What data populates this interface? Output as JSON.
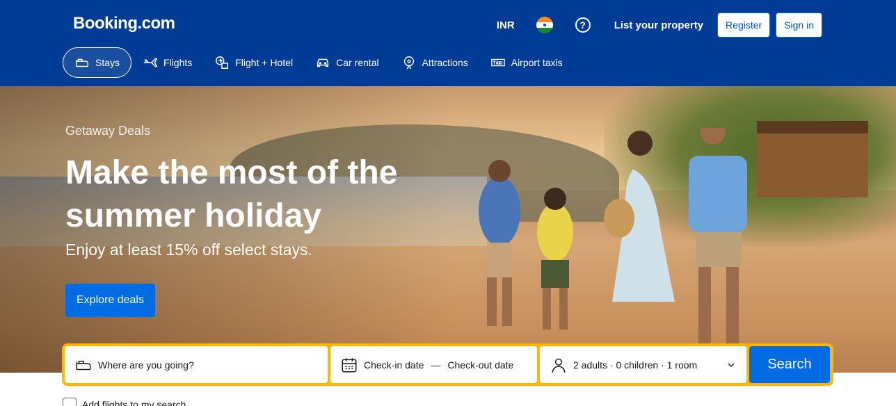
{
  "header": {
    "logo": "Booking.com",
    "currency": "INR",
    "help_icon_text": "?",
    "list_property": "List your property",
    "register": "Register",
    "sign_in": "Sign in",
    "icons": {
      "flag": "india-flag-icon",
      "help": "help-icon"
    }
  },
  "nav": {
    "items": [
      {
        "label": "Stays",
        "icon": "bed-icon",
        "active": true
      },
      {
        "label": "Flights",
        "icon": "plane-icon",
        "active": false
      },
      {
        "label": "Flight + Hotel",
        "icon": "flight-hotel-icon",
        "active": false
      },
      {
        "label": "Car rental",
        "icon": "car-icon",
        "active": false
      },
      {
        "label": "Attractions",
        "icon": "attractions-icon",
        "active": false
      },
      {
        "label": "Airport taxis",
        "icon": "taxi-icon",
        "active": false
      }
    ]
  },
  "hero": {
    "eyebrow": "Getaway Deals",
    "headline": "Make the most of the summer holiday",
    "subline": "Enjoy at least 15% off select stays.",
    "cta": "Explore deals"
  },
  "search": {
    "destination_placeholder": "Where are you going?",
    "checkin": "Check-in date",
    "separator": "—",
    "checkout": "Check-out date",
    "guests": "2 adults · 0 children · 1 room",
    "button": "Search"
  },
  "options": {
    "add_flights": "Add flights to my search"
  },
  "colors": {
    "brand_blue": "#003b95",
    "action_blue": "#006ce4",
    "search_border": "#ffb700"
  }
}
